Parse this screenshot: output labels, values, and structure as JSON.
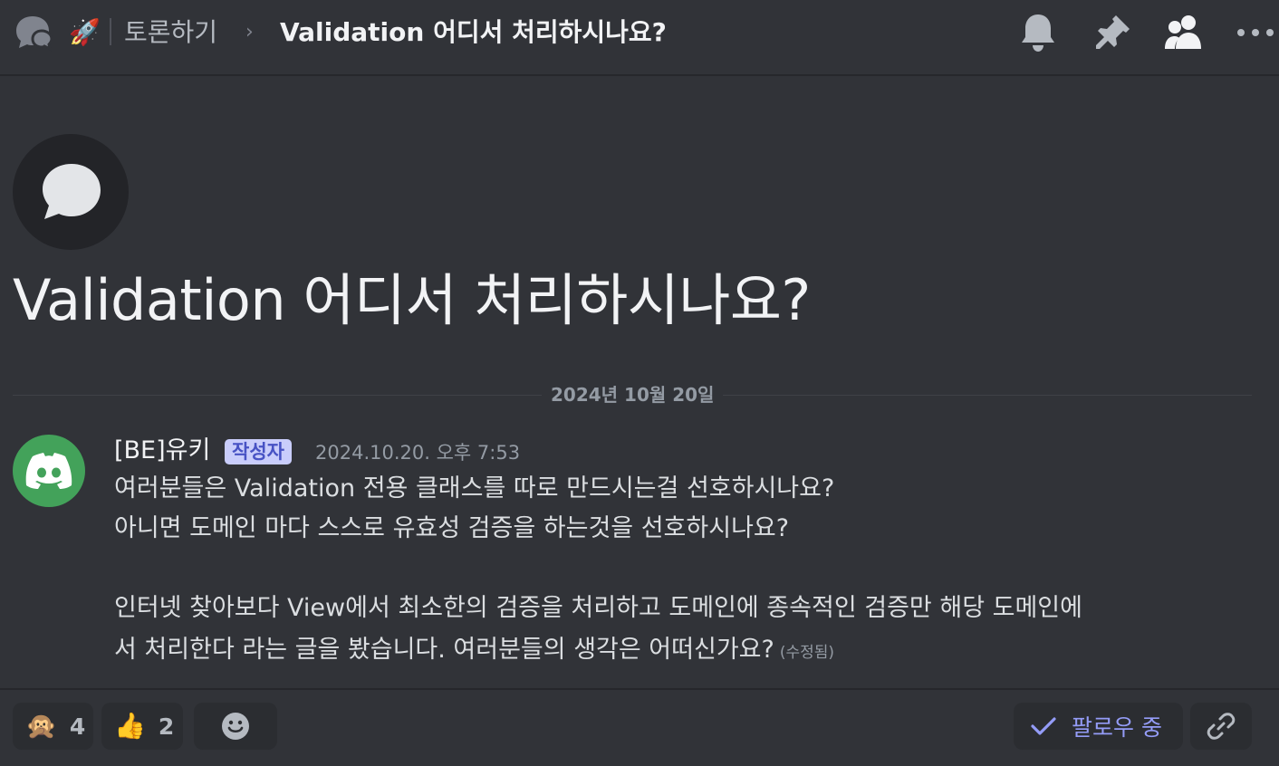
{
  "header": {
    "channel_icon": "rocket-emoji",
    "channel_emoji": "🚀",
    "channel_name": "토론하기",
    "chevron": "›",
    "thread_title": "Validation 어디서 처리하시나요?",
    "icons": [
      "forum-icon",
      "bell-icon",
      "pin-icon",
      "members-icon",
      "more-icon"
    ]
  },
  "thread": {
    "title": "Validation 어디서 처리하시나요?",
    "date_divider": "2024년 10월 20일"
  },
  "message": {
    "author": "[BE]유키",
    "badge": "작성자",
    "timestamp": "2024.10.20. 오후 7:53",
    "lines": [
      "여러분들은 Validation 전용 클래스를 따로 만드시는걸 선호하시나요?",
      "아니면 도메인 마다 스스로 유효성 검증을 하는것을 선호하시나요?",
      "",
      "인터넷 찾아보다 View에서 최소한의 검증을 처리하고 도메인에 종속적인 검증만 해당 도메인에",
      "서 처리한다 라는 글을 봤습니다. 여러분들의 생각은 어떠신가요?"
    ],
    "edited_label": "(수정됨)"
  },
  "reactions": [
    {
      "emoji": "🙊",
      "count": "4"
    },
    {
      "emoji": "👍",
      "count": "2"
    }
  ],
  "actions": {
    "follow_label": "팔로우 중"
  },
  "colors": {
    "background": "#313338",
    "avatar_green": "#43a25a",
    "badge_bg": "#c9cdfb",
    "accent": "#949cf7"
  }
}
